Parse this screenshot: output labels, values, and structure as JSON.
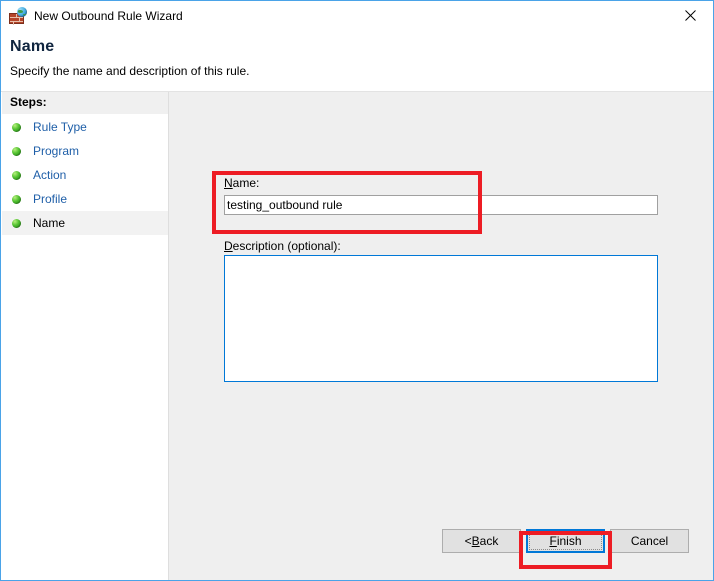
{
  "window": {
    "title": "New Outbound Rule Wizard",
    "title_icon": "firewall-globe-icon",
    "close_label": "✕",
    "border_color": "#4aa3e8"
  },
  "header": {
    "title": "Name",
    "subtitle": "Specify the name and description of this rule."
  },
  "sidebar": {
    "heading": "Steps:",
    "items": [
      {
        "label": "Rule Type",
        "state": "completed",
        "bullet": "green-orb-icon"
      },
      {
        "label": "Program",
        "state": "completed",
        "bullet": "green-orb-icon"
      },
      {
        "label": "Action",
        "state": "completed",
        "bullet": "green-orb-icon"
      },
      {
        "label": "Profile",
        "state": "completed",
        "bullet": "green-orb-icon"
      },
      {
        "label": "Name",
        "state": "current",
        "bullet": "green-orb-icon"
      }
    ]
  },
  "main": {
    "name_field": {
      "label_prefix": "",
      "label_accel": "N",
      "label_rest": "ame:",
      "value": "testing_outbound rule",
      "placeholder": ""
    },
    "description_field": {
      "label_accel": "D",
      "label_rest": "escription (optional):",
      "value": "",
      "placeholder": ""
    }
  },
  "footer": {
    "back": {
      "prefix": "< ",
      "accel": "B",
      "rest": "ack"
    },
    "finish": {
      "prefix": "",
      "accel": "F",
      "rest": "inish"
    },
    "cancel": {
      "prefix": "",
      "accel": "",
      "rest": "Cancel"
    }
  },
  "annotations": {
    "color": "#ed1c24",
    "boxes": [
      {
        "target": "name-field-group"
      },
      {
        "target": "finish-button"
      }
    ]
  }
}
